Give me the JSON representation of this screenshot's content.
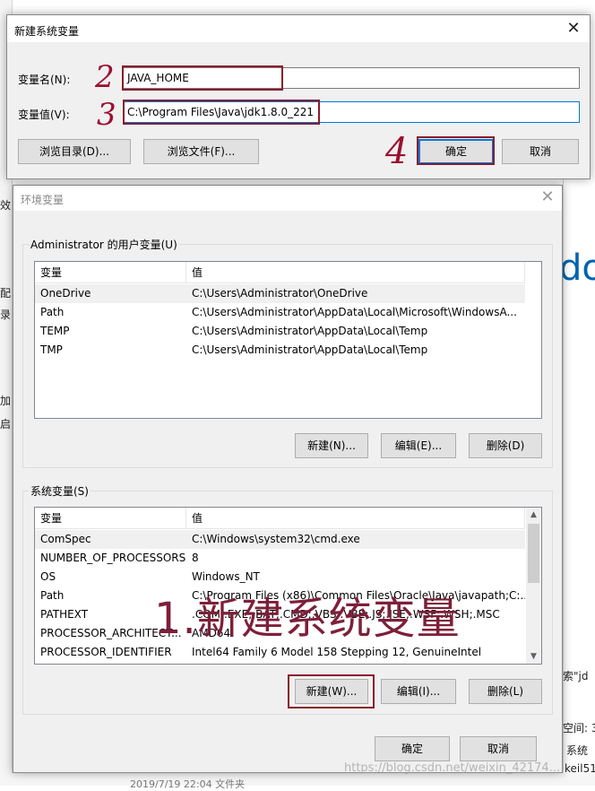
{
  "new_dialog": {
    "title": "新建系统变量",
    "name_label": "变量名(N):",
    "name_value": "JAVA_HOME",
    "value_label": "变量值(V):",
    "value_value": "C:\\Program Files\\Java\\jdk1.8.0_221",
    "browse_dir": "浏览目录(D)...",
    "browse_file": "浏览文件(F)...",
    "ok": "确定",
    "cancel": "取消",
    "close": "✕"
  },
  "env_dialog": {
    "title": "环境变量",
    "close": "✕",
    "user_group_title": "Administrator 的用户变量(U)",
    "columns": [
      "变量",
      "值"
    ],
    "user_vars": [
      {
        "name": "OneDrive",
        "value": "C:\\Users\\Administrator\\OneDrive"
      },
      {
        "name": "Path",
        "value": "C:\\Users\\Administrator\\AppData\\Local\\Microsoft\\WindowsA..."
      },
      {
        "name": "TEMP",
        "value": "C:\\Users\\Administrator\\AppData\\Local\\Temp"
      },
      {
        "name": "TMP",
        "value": "C:\\Users\\Administrator\\AppData\\Local\\Temp"
      }
    ],
    "user_buttons": {
      "new": "新建(N)...",
      "edit": "编辑(E)...",
      "delete": "删除(D)"
    },
    "sys_group_title": "系统变量(S)",
    "sys_vars": [
      {
        "name": "ComSpec",
        "value": "C:\\Windows\\system32\\cmd.exe"
      },
      {
        "name": "NUMBER_OF_PROCESSORS",
        "value": "8"
      },
      {
        "name": "OS",
        "value": "Windows_NT"
      },
      {
        "name": "Path",
        "value": "C:\\Program Files (x86)\\Common Files\\Oracle\\Java\\javapath;C:..."
      },
      {
        "name": "PATHEXT",
        "value": ".COM;.EXE;.BAT;.CMD;.VBS;.VBE;.JS;.JSE;.WSF;.WSH;.MSC"
      },
      {
        "name": "PROCESSOR_ARCHITECT...",
        "value": "AMD64"
      },
      {
        "name": "PROCESSOR_IDENTIFIER",
        "value": "Intel64 Family 6 Model 158 Stepping 12, GenuineIntel"
      }
    ],
    "sys_buttons": {
      "new": "新建(W)...",
      "edit": "编辑(I)...",
      "delete": "删除(L)"
    },
    "ok": "确定",
    "cancel": "取消"
  },
  "annotations": {
    "n1": "1.新建系统变量",
    "n2": "2",
    "n3": "3",
    "n4": "4"
  },
  "background": {
    "left_fragments": [
      "效",
      "配",
      "录",
      "加",
      "启"
    ],
    "right_fragments": [
      "索\"jd",
      "空间: 3",
      "系统",
      "keil51",
      "↓ ▾"
    ],
    "right_big": "do",
    "bottom_fragment": "2019/7/19 22:04      文件夹"
  },
  "watermark": "https://blog.csdn.net/weixin_42174..."
}
